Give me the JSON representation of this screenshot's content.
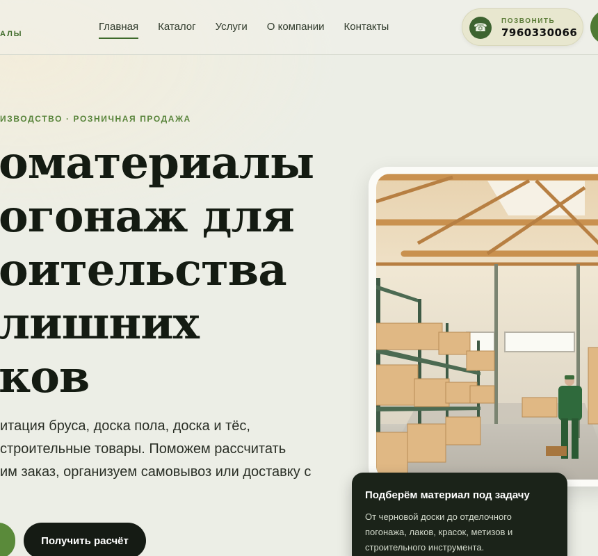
{
  "header": {
    "logo_tail": "АЛЫ",
    "nav": [
      {
        "label": "Главная",
        "active": true
      },
      {
        "label": "Каталог"
      },
      {
        "label": "Услуги"
      },
      {
        "label": "О компании"
      },
      {
        "label": "Контакты"
      }
    ],
    "call": {
      "label": "ПОЗВОНИТЬ",
      "number": "7960330066",
      "icon": "phone-icon"
    }
  },
  "hero": {
    "eyebrow": "ИЗВОДСТВО · РОЗНИЧНАЯ ПРОДАЖА",
    "title_lines": [
      "оматериалы",
      "огонаж для",
      "оительства",
      "лишних",
      "ков"
    ],
    "desc_lines": [
      "итация бруса, доска пола, доска и тёс,",
      "строительные товары. Поможем рассчитать",
      "им заказ, организуем самовывоз или доставку с"
    ],
    "cta_label": "Получить расчёт"
  },
  "info_card": {
    "title": "Подберём материал под задачу",
    "text_lines": [
      "От черновой доски до отделочного",
      "погонажа, лаков, красок, метизов и",
      "строительного инструмента."
    ]
  },
  "colors": {
    "accent": "#3e6a2b",
    "dark": "#151b14",
    "background": "#eceee6",
    "pill": "#e8e7cf"
  }
}
